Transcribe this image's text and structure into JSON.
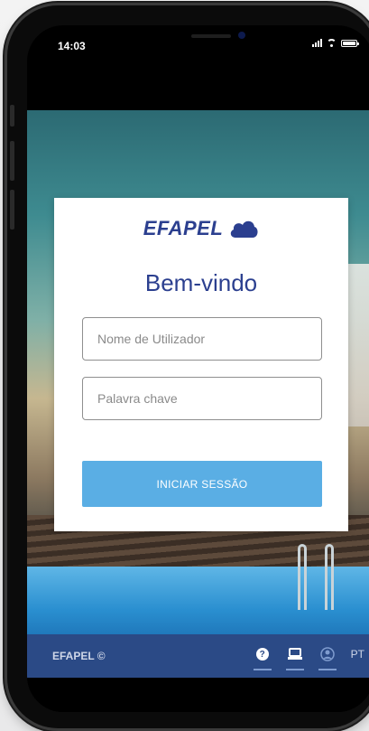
{
  "status_bar": {
    "time": "14:03"
  },
  "login": {
    "brand": "EFAPEL",
    "welcome": "Bem-vindo",
    "username_placeholder": "Nome de Utilizador",
    "password_placeholder": "Palavra chave",
    "submit_label": "INICIAR SESSÃO"
  },
  "footer": {
    "brand": "EFAPEL ©",
    "language": "PT",
    "icons": [
      "help-icon",
      "device-icon",
      "account-icon"
    ]
  },
  "colors": {
    "brand_blue": "#2b3f8f",
    "button_blue": "#5aaee4",
    "footer_blue": "#2b4a86"
  }
}
